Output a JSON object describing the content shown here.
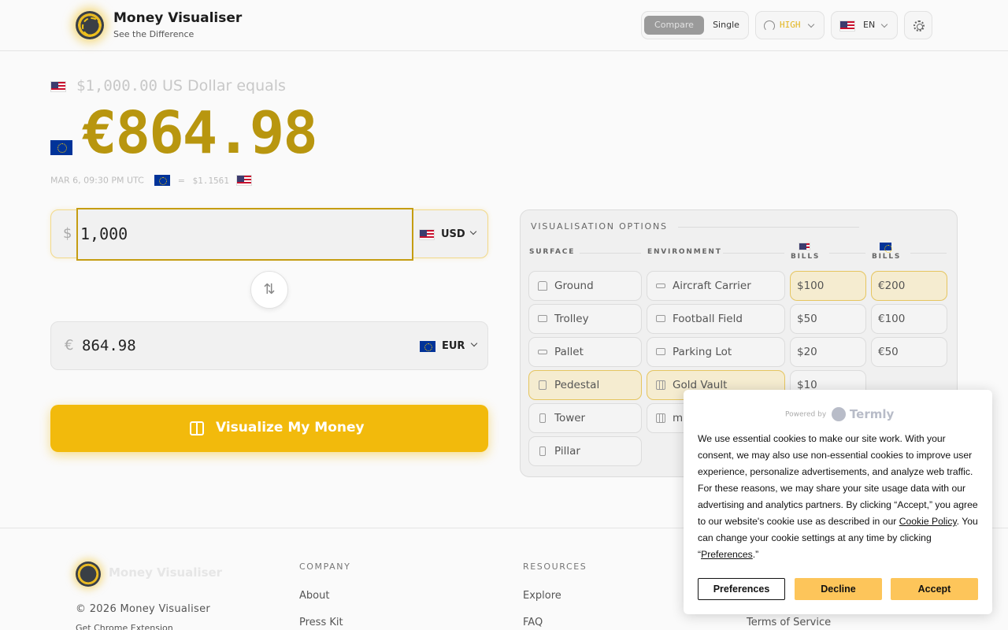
{
  "header": {
    "brand_name": "Money Visualiser",
    "brand_tagline": "See the Difference",
    "mode_compare": "Compare",
    "mode_single": "Single",
    "quality": "HIGH",
    "language": "EN"
  },
  "conversion": {
    "from_amount": "$1,000.00",
    "from_label": "US Dollar equals",
    "result": "€864.98",
    "timestamp": "MAR 6, 09:30 PM UTC",
    "rate_equals": "=",
    "rate_value": "$1.1561"
  },
  "converter": {
    "from_symbol": "$",
    "from_value": "1,000",
    "from_currency": "USD",
    "to_symbol": "€",
    "to_value": "864.98",
    "to_currency": "EUR",
    "swap_icon": "⇅",
    "button_label": "Visualize My Money"
  },
  "options": {
    "title": "VISUALISATION OPTIONS",
    "surface_head": "SURFACE",
    "environment_head": "ENVIRONMENT",
    "usd_bills_head": "BILLS",
    "eur_bills_head": "BILLS",
    "surfaces": [
      "Ground",
      "Trolley",
      "Pallet",
      "Pedestal",
      "Tower",
      "Pillar"
    ],
    "environments": [
      "Aircraft Carrier",
      "Football Field",
      "Parking Lot",
      "Gold Vault",
      "m"
    ],
    "usd_bills": [
      "$100",
      "$50",
      "$20",
      "$10"
    ],
    "eur_bills": [
      "€200",
      "€100",
      "€50"
    ]
  },
  "footer": {
    "brand_name": "Money Visualiser",
    "copyright": "© 2026 Money Visualiser",
    "chrome_link": "Get Chrome Extension",
    "company_head": "COMPANY",
    "resources_head": "RESOURCES",
    "company_links": [
      "About",
      "Press Kit"
    ],
    "resources_links": [
      "Explore",
      "FAQ"
    ],
    "legal_link": "Terms of Service"
  },
  "cookie": {
    "powered_by": "Powered by",
    "provider": "Termly",
    "text_1": "We use essential cookies to make our site work. With your consent, we may also use non-essential cookies to improve user experience, personalize advertisements, and analyze web traffic. For these reasons, we may share your site usage data with our advertising and analytics partners. By clicking “Accept,” you agree to our website's cookie use as described in our ",
    "policy_link": "Cookie Policy",
    "text_2": ". You can change your cookie settings at any time by clicking “",
    "preferences_link": "Preferences",
    "text_3": ".”",
    "btn_preferences": "Preferences",
    "btn_decline": "Decline",
    "btn_accept": "Accept"
  }
}
